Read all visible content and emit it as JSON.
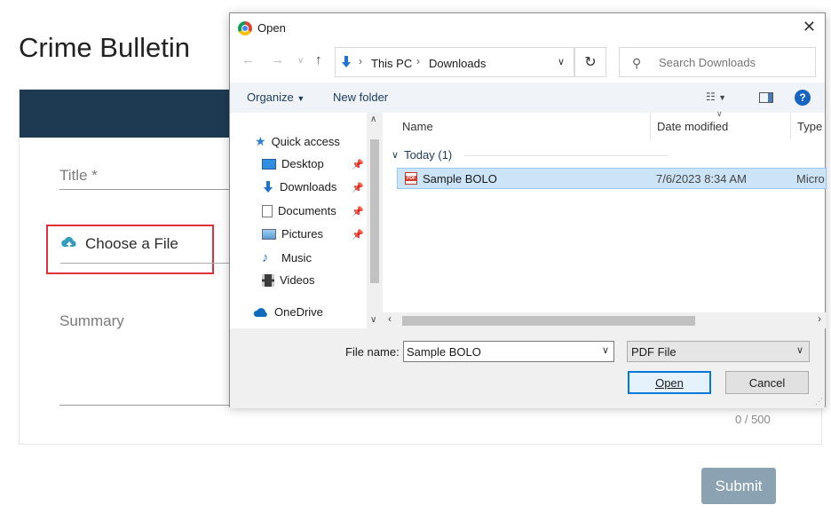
{
  "page": {
    "title": "Crime Bulletin",
    "title_field_label": "Title *",
    "choose_file_label": "Choose a File",
    "summary_label": "Summary",
    "char_counter": "0 / 500",
    "submit_label": "Submit",
    "header_color": "#1e3a52",
    "highlight_color": "#e0303a"
  },
  "dialog": {
    "title": "Open",
    "breadcrumb": [
      "This PC",
      "Downloads"
    ],
    "search_placeholder": "Search Downloads",
    "toolbar": {
      "organize": "Organize",
      "new_folder": "New folder"
    },
    "nav_items": [
      {
        "label": "Quick access",
        "icon": "star-icon",
        "pinned": false
      },
      {
        "label": "Desktop",
        "icon": "desktop-icon",
        "pinned": true
      },
      {
        "label": "Downloads",
        "icon": "download-arrow-icon",
        "pinned": true
      },
      {
        "label": "Documents",
        "icon": "document-icon",
        "pinned": true
      },
      {
        "label": "Pictures",
        "icon": "pictures-icon",
        "pinned": true
      },
      {
        "label": "Music",
        "icon": "music-note-icon",
        "pinned": false
      },
      {
        "label": "Videos",
        "icon": "film-icon",
        "pinned": false
      },
      {
        "label": "OneDrive",
        "icon": "cloud-icon",
        "pinned": false
      }
    ],
    "columns": {
      "name": "Name",
      "date_modified": "Date modified",
      "type": "Type"
    },
    "group_label": "Today (1)",
    "files": [
      {
        "name": "Sample BOLO",
        "date_modified": "7/6/2023 8:34 AM",
        "type": "Micro"
      }
    ],
    "file_name_label": "File name:",
    "file_name_value": "Sample BOLO",
    "file_type_value": "PDF File",
    "open_label": "Open",
    "cancel_label": "Cancel"
  }
}
